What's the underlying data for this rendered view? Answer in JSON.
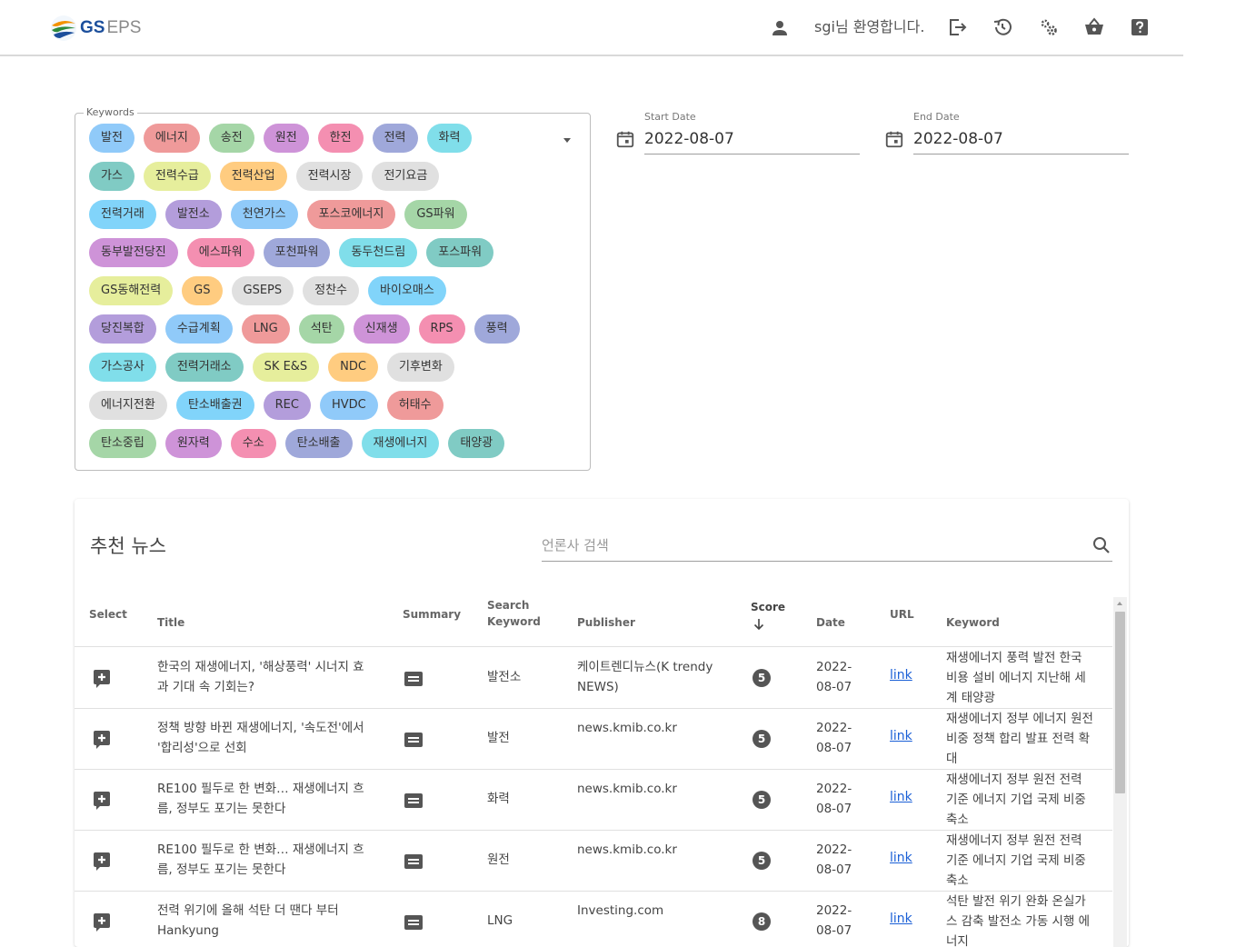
{
  "header": {
    "logo_gs": "GS",
    "logo_eps": "EPS",
    "welcome": "sgi님 환영합니다."
  },
  "keywords": {
    "legend": "Keywords",
    "rows": [
      [
        {
          "label": "발전",
          "color": "#90caf9"
        },
        {
          "label": "에너지",
          "color": "#ef9a9a"
        },
        {
          "label": "송전",
          "color": "#a5d6a7"
        },
        {
          "label": "원전",
          "color": "#ce93d8"
        },
        {
          "label": "한전",
          "color": "#f48fb1"
        },
        {
          "label": "전력",
          "color": "#9fa8da"
        },
        {
          "label": "화력",
          "color": "#80deea"
        }
      ],
      [
        {
          "label": "가스",
          "color": "#80cbc4"
        },
        {
          "label": "전력수급",
          "color": "#e6ee9c"
        },
        {
          "label": "전력산업",
          "color": "#ffcc80"
        },
        {
          "label": "전력시장",
          "color": "#e0e0e0"
        },
        {
          "label": "전기요금",
          "color": "#e0e0e0"
        }
      ],
      [
        {
          "label": "전력거래",
          "color": "#81d4fa"
        },
        {
          "label": "발전소",
          "color": "#b39ddb"
        },
        {
          "label": "천연가스",
          "color": "#90caf9"
        },
        {
          "label": "포스코에너지",
          "color": "#ef9a9a"
        },
        {
          "label": "GS파워",
          "color": "#a5d6a7"
        }
      ],
      [
        {
          "label": "동부발전당진",
          "color": "#ce93d8"
        },
        {
          "label": "에스파워",
          "color": "#f48fb1"
        },
        {
          "label": "포천파워",
          "color": "#9fa8da"
        },
        {
          "label": "동두천드림",
          "color": "#80deea"
        },
        {
          "label": "포스파워",
          "color": "#80cbc4"
        }
      ],
      [
        {
          "label": "GS동해전력",
          "color": "#e6ee9c"
        },
        {
          "label": "GS",
          "color": "#ffcc80"
        },
        {
          "label": "GSEPS",
          "color": "#e0e0e0"
        },
        {
          "label": "정찬수",
          "color": "#e0e0e0"
        },
        {
          "label": "바이오매스",
          "color": "#81d4fa"
        }
      ],
      [
        {
          "label": "당진복합",
          "color": "#b39ddb"
        },
        {
          "label": "수급계획",
          "color": "#90caf9"
        },
        {
          "label": "LNG",
          "color": "#ef9a9a"
        },
        {
          "label": "석탄",
          "color": "#a5d6a7"
        },
        {
          "label": "신재생",
          "color": "#ce93d8"
        },
        {
          "label": "RPS",
          "color": "#f48fb1"
        },
        {
          "label": "풍력",
          "color": "#9fa8da"
        }
      ],
      [
        {
          "label": "가스공사",
          "color": "#80deea"
        },
        {
          "label": "전력거래소",
          "color": "#80cbc4"
        },
        {
          "label": "SK E&S",
          "color": "#e6ee9c"
        },
        {
          "label": "NDC",
          "color": "#ffcc80"
        },
        {
          "label": "기후변화",
          "color": "#e0e0e0"
        }
      ],
      [
        {
          "label": "에너지전환",
          "color": "#e0e0e0"
        },
        {
          "label": "탄소배출권",
          "color": "#81d4fa"
        },
        {
          "label": "REC",
          "color": "#b39ddb"
        },
        {
          "label": "HVDC",
          "color": "#90caf9"
        },
        {
          "label": "허태수",
          "color": "#ef9a9a"
        }
      ],
      [
        {
          "label": "탄소중립",
          "color": "#a5d6a7"
        },
        {
          "label": "원자력",
          "color": "#ce93d8"
        },
        {
          "label": "수소",
          "color": "#f48fb1"
        },
        {
          "label": "탄소배출",
          "color": "#9fa8da"
        },
        {
          "label": "재생에너지",
          "color": "#80deea"
        },
        {
          "label": "태양광",
          "color": "#80cbc4"
        }
      ]
    ]
  },
  "start_date": {
    "label": "Start Date",
    "value": "2022-08-07"
  },
  "end_date": {
    "label": "End Date",
    "value": "2022-08-07"
  },
  "news": {
    "title": "추천 뉴스",
    "search_placeholder": "언론사 검색",
    "columns": {
      "select": "Select",
      "title": "Title",
      "summary": "Summary",
      "search_keyword": "Search Keyword",
      "publisher": "Publisher",
      "score": "Score",
      "date": "Date",
      "url": "URL",
      "keyword": "Keyword"
    },
    "rows": [
      {
        "title": "한국의 재생에너지, '해상풍력' 시너지 효과 기대 속 기회는?",
        "search_keyword": "발전소",
        "publisher": "케이트렌디뉴스(K trendy NEWS)",
        "score": "5",
        "date": "2022-08-07",
        "url": "link",
        "keyword": "재생에너지 풍력 발전 한국 비용 설비 에너지 지난해 세계 태양광"
      },
      {
        "title": "정책 방향 바뀐 재생에너지, '속도전'에서 '합리성'으로 선회",
        "search_keyword": "발전",
        "publisher": "news.kmib.co.kr",
        "score": "5",
        "date": "2022-08-07",
        "url": "link",
        "keyword": "재생에너지 정부 에너지 원전 비중 정책 합리 발표 전력 확대"
      },
      {
        "title": "RE100 필두로 한 변화… 재생에너지 흐름, 정부도 포기는 못한다",
        "search_keyword": "화력",
        "publisher": "news.kmib.co.kr",
        "score": "5",
        "date": "2022-08-07",
        "url": "link",
        "keyword": "재생에너지 정부 원전 전력 기준 에너지 기업 국제 비중 축소"
      },
      {
        "title": "RE100 필두로 한 변화… 재생에너지 흐름, 정부도 포기는 못한다",
        "search_keyword": "원전",
        "publisher": "news.kmib.co.kr",
        "score": "5",
        "date": "2022-08-07",
        "url": "link",
        "keyword": "재생에너지 정부 원전 전력 기준 에너지 기업 국제 비중 축소"
      },
      {
        "title": "전력 위기에 올해 석탄 더 땐다 부터 Hankyung",
        "search_keyword": "LNG",
        "publisher": "Investing.com",
        "score": "8",
        "date": "2022-08-07",
        "url": "link",
        "keyword": "석탄 발전 위기 완화 온실가스 감축 발전소 가동 시행 에너지"
      }
    ]
  }
}
